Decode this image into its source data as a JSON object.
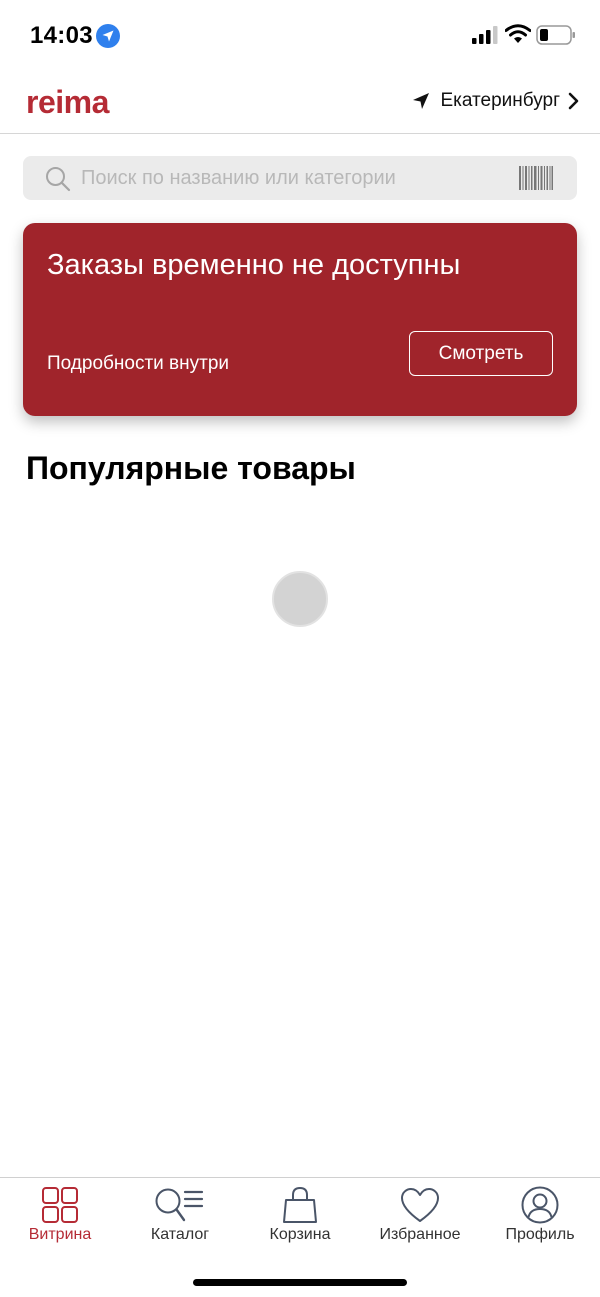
{
  "status_bar": {
    "time": "14:03"
  },
  "header": {
    "brand": "reima",
    "city": "Екатеринбург"
  },
  "search": {
    "placeholder": "Поиск по названию или категории"
  },
  "banner": {
    "title": "Заказы временно не доступны",
    "subtitle": "Подробности внутри",
    "button_label": "Смотреть",
    "color": "#a0242b"
  },
  "popular": {
    "title": "Популярные товары"
  },
  "tabs": [
    {
      "label": "Витрина",
      "icon": "grid-icon",
      "active": true
    },
    {
      "label": "Каталог",
      "icon": "catalog-search-icon"
    },
    {
      "label": "Корзина",
      "icon": "shopping-bag-icon"
    },
    {
      "label": "Избранное",
      "icon": "heart-icon"
    },
    {
      "label": "Профиль",
      "icon": "user-icon"
    }
  ],
  "colors": {
    "accent": "#b52b35",
    "inactive_icon": "#4a5568"
  }
}
